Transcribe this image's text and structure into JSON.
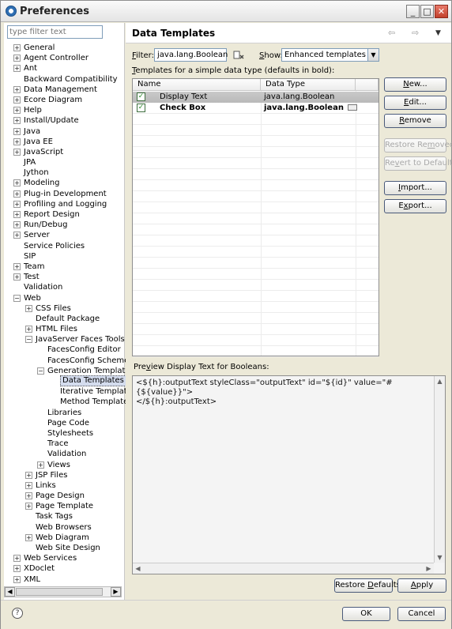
{
  "window": {
    "title": "Preferences",
    "minimize_glyph": "_",
    "maximize_glyph": "□",
    "close_glyph": "✕"
  },
  "left": {
    "filter_placeholder": "type filter text",
    "tree": [
      {
        "label": "General",
        "depth": 0,
        "expander": "+"
      },
      {
        "label": "Agent Controller",
        "depth": 0,
        "expander": "+"
      },
      {
        "label": "Ant",
        "depth": 0,
        "expander": "+"
      },
      {
        "label": "Backward Compatibility",
        "depth": 0,
        "expander": ""
      },
      {
        "label": "Data Management",
        "depth": 0,
        "expander": "+"
      },
      {
        "label": "Ecore Diagram",
        "depth": 0,
        "expander": "+"
      },
      {
        "label": "Help",
        "depth": 0,
        "expander": "+"
      },
      {
        "label": "Install/Update",
        "depth": 0,
        "expander": "+"
      },
      {
        "label": "Java",
        "depth": 0,
        "expander": "+"
      },
      {
        "label": "Java EE",
        "depth": 0,
        "expander": "+"
      },
      {
        "label": "JavaScript",
        "depth": 0,
        "expander": "+"
      },
      {
        "label": "JPA",
        "depth": 0,
        "expander": ""
      },
      {
        "label": "Jython",
        "depth": 0,
        "expander": ""
      },
      {
        "label": "Modeling",
        "depth": 0,
        "expander": "+"
      },
      {
        "label": "Plug-in Development",
        "depth": 0,
        "expander": "+"
      },
      {
        "label": "Profiling and Logging",
        "depth": 0,
        "expander": "+"
      },
      {
        "label": "Report Design",
        "depth": 0,
        "expander": "+"
      },
      {
        "label": "Run/Debug",
        "depth": 0,
        "expander": "+"
      },
      {
        "label": "Server",
        "depth": 0,
        "expander": "+"
      },
      {
        "label": "Service Policies",
        "depth": 0,
        "expander": ""
      },
      {
        "label": "SIP",
        "depth": 0,
        "expander": ""
      },
      {
        "label": "Team",
        "depth": 0,
        "expander": "+"
      },
      {
        "label": "Test",
        "depth": 0,
        "expander": "+"
      },
      {
        "label": "Validation",
        "depth": 0,
        "expander": ""
      },
      {
        "label": "Web",
        "depth": 0,
        "expander": "−"
      },
      {
        "label": "CSS Files",
        "depth": 1,
        "expander": "+"
      },
      {
        "label": "Default Package",
        "depth": 1,
        "expander": ""
      },
      {
        "label": "HTML Files",
        "depth": 1,
        "expander": "+"
      },
      {
        "label": "JavaServer Faces Tools",
        "depth": 1,
        "expander": "−"
      },
      {
        "label": "FacesConfig Editor",
        "depth": 2,
        "expander": ""
      },
      {
        "label": "FacesConfig Schemes",
        "depth": 2,
        "expander": ""
      },
      {
        "label": "Generation Templates",
        "depth": 2,
        "expander": "−"
      },
      {
        "label": "Data Templates",
        "depth": 3,
        "expander": "",
        "selected": true
      },
      {
        "label": "Iterative Templates",
        "depth": 3,
        "expander": ""
      },
      {
        "label": "Method Templates",
        "depth": 3,
        "expander": ""
      },
      {
        "label": "Libraries",
        "depth": 2,
        "expander": ""
      },
      {
        "label": "Page Code",
        "depth": 2,
        "expander": ""
      },
      {
        "label": "Stylesheets",
        "depth": 2,
        "expander": ""
      },
      {
        "label": "Trace",
        "depth": 2,
        "expander": ""
      },
      {
        "label": "Validation",
        "depth": 2,
        "expander": ""
      },
      {
        "label": "Views",
        "depth": 2,
        "expander": "+"
      },
      {
        "label": "JSP Files",
        "depth": 1,
        "expander": "+"
      },
      {
        "label": "Links",
        "depth": 1,
        "expander": "+"
      },
      {
        "label": "Page Design",
        "depth": 1,
        "expander": "+"
      },
      {
        "label": "Page Template",
        "depth": 1,
        "expander": "+"
      },
      {
        "label": "Task Tags",
        "depth": 1,
        "expander": ""
      },
      {
        "label": "Web Browsers",
        "depth": 1,
        "expander": ""
      },
      {
        "label": "Web Diagram",
        "depth": 1,
        "expander": "+"
      },
      {
        "label": "Web Site Design",
        "depth": 1,
        "expander": ""
      },
      {
        "label": "Web Services",
        "depth": 0,
        "expander": "+"
      },
      {
        "label": "XDoclet",
        "depth": 0,
        "expander": "+"
      },
      {
        "label": "XML",
        "depth": 0,
        "expander": "+"
      }
    ],
    "scroll_left": "◀",
    "scroll_right": "▶"
  },
  "main": {
    "title": "Data Templates",
    "nav_back": "⇦",
    "nav_forward": "⇨",
    "nav_menu": "▼",
    "filter_label_u": "F",
    "filter_label_rest": "ilter:",
    "filter_value": "java.lang.Boolean",
    "show_label_u": "S",
    "show_label_rest": "how:",
    "show_value": "Enhanced templates",
    "show_arrow": "▼",
    "templates_label_u": "T",
    "templates_label_rest": "emplates for a simple data type (defaults in bold):",
    "table": {
      "col_name": "Name",
      "col_type": "Data Type",
      "rows": [
        {
          "checked": "✓",
          "name": "Display Text",
          "type": "java.lang.Boolean",
          "bold": false,
          "selected": true
        },
        {
          "checked": "✓",
          "name": "Check Box",
          "type": "java.lang.Boolean",
          "bold": true,
          "selected": false
        }
      ]
    },
    "buttons": {
      "new_u": "N",
      "new_rest": "ew...",
      "edit_u": "E",
      "edit_rest": "dit...",
      "remove_u": "R",
      "remove_rest": "emove",
      "restore_removed_pre": "Restore Re",
      "restore_removed_u": "m",
      "restore_removed_post": "oved",
      "revert_pre": "Re",
      "revert_u": "v",
      "revert_post": "ert to Default",
      "import_u": "I",
      "import_rest": "mport...",
      "export_pre": "E",
      "export_u": "x",
      "export_post": "port..."
    },
    "preview_label_pre": "Pre",
    "preview_label_u": "v",
    "preview_label_post": "iew Display Text for Booleans:",
    "preview_text": "<${h}:outputText styleClass=\"outputText\" id=\"${id}\" value=\"#{${value}}\">\n</${h}:outputText>",
    "scroll_up": "▲",
    "scroll_down": "▼",
    "scroll_left": "◀",
    "scroll_right": "▶",
    "restore_defaults_pre": "Restore ",
    "restore_defaults_u": "D",
    "restore_defaults_post": "efaults",
    "apply_u": "A",
    "apply_rest": "pply"
  },
  "footer": {
    "help_glyph": "?",
    "ok": "OK",
    "cancel": "Cancel"
  }
}
